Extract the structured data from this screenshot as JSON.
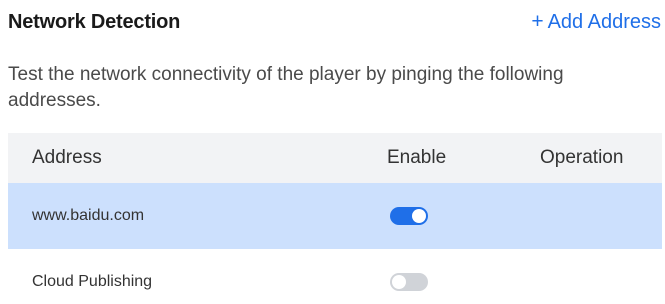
{
  "header": {
    "title": "Network Detection",
    "add_link_icon": "+",
    "add_link_label": "Add Address"
  },
  "description": "Test the network connectivity of the player by pinging the following addresses.",
  "table": {
    "columns": [
      "Address",
      "Enable",
      "Operation"
    ],
    "rows": [
      {
        "address": "www.baidu.com",
        "enabled": true,
        "selected": true
      },
      {
        "address": "Cloud Publishing",
        "enabled": false,
        "selected": false
      }
    ]
  },
  "colors": {
    "accent": "#1f6fe8",
    "selected_row": "#cce0fd",
    "header_row": "#f2f3f5",
    "toggle_off": "#d0d3d8"
  }
}
